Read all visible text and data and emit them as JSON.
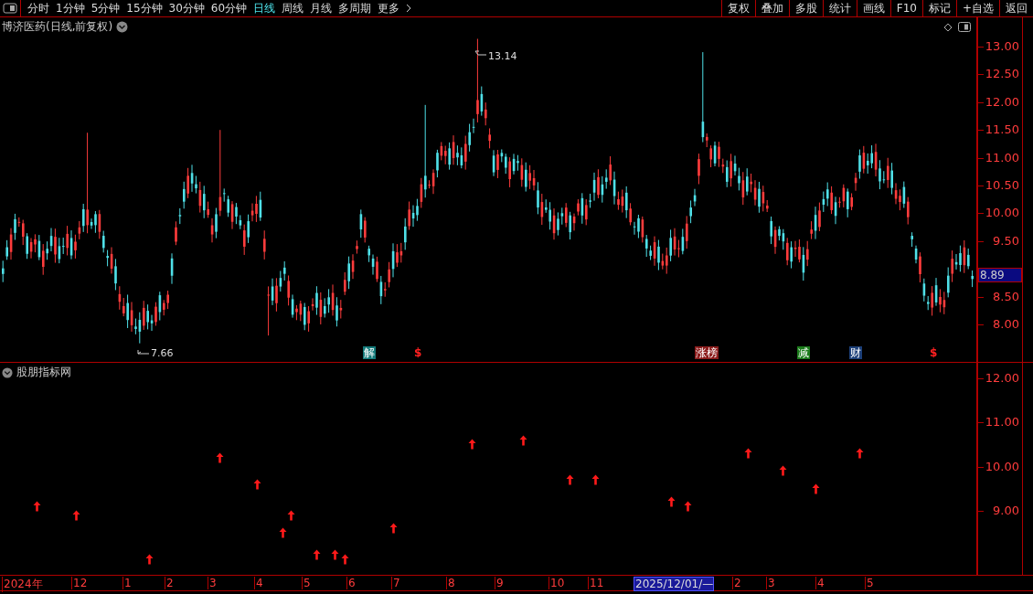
{
  "toolbar": {
    "periods": [
      {
        "label": "分时",
        "selected": false
      },
      {
        "label": "1分钟",
        "selected": false
      },
      {
        "label": "5分钟",
        "selected": false
      },
      {
        "label": "15分钟",
        "selected": false
      },
      {
        "label": "30分钟",
        "selected": false
      },
      {
        "label": "60分钟",
        "selected": false
      },
      {
        "label": "日线",
        "selected": true
      },
      {
        "label": "周线",
        "selected": false
      },
      {
        "label": "月线",
        "selected": false
      },
      {
        "label": "多周期",
        "selected": false
      }
    ],
    "more": "更多",
    "buttons": [
      "复权",
      "叠加",
      "多股",
      "统计",
      "画线",
      "F10",
      "标记",
      "+自选",
      "返回"
    ]
  },
  "price_panel": {
    "title": "博济医药(日线,前复权)",
    "y_axis": [
      "13.00",
      "12.50",
      "12.00",
      "11.50",
      "11.00",
      "10.50",
      "10.00",
      "9.50",
      "8.50",
      "8.00"
    ],
    "current_price": "8.89",
    "high_label": "13.14",
    "low_label": "7.66",
    "events": [
      {
        "text": "解",
        "color": "#137a7a"
      },
      {
        "text": "$",
        "color": "#000000"
      },
      {
        "text": "涨榜",
        "color": "#8b1c1c"
      },
      {
        "text": "减",
        "color": "#1a7a1a"
      },
      {
        "text": "财",
        "color": "#1c3f78"
      },
      {
        "text": "$",
        "color": "#000000"
      }
    ]
  },
  "indicator_panel": {
    "title": "股朋指标网",
    "y_axis": [
      "12.00",
      "11.00",
      "10.00",
      "9.00"
    ]
  },
  "date_axis": [
    {
      "label": "2024年",
      "selected": false
    },
    {
      "label": "12",
      "selected": false
    },
    {
      "label": "1",
      "selected": false
    },
    {
      "label": "2",
      "selected": false
    },
    {
      "label": "3",
      "selected": false
    },
    {
      "label": "4",
      "selected": false
    },
    {
      "label": "5",
      "selected": false
    },
    {
      "label": "6",
      "selected": false
    },
    {
      "label": "7",
      "selected": false
    },
    {
      "label": "8",
      "selected": false
    },
    {
      "label": "9",
      "selected": false
    },
    {
      "label": "10",
      "selected": false
    },
    {
      "label": "11",
      "selected": false
    },
    {
      "label": "2025/12/01/—",
      "selected": true
    },
    {
      "label": "2",
      "selected": false
    },
    {
      "label": "3",
      "selected": false
    },
    {
      "label": "4",
      "selected": false
    },
    {
      "label": "5",
      "selected": false
    }
  ]
}
